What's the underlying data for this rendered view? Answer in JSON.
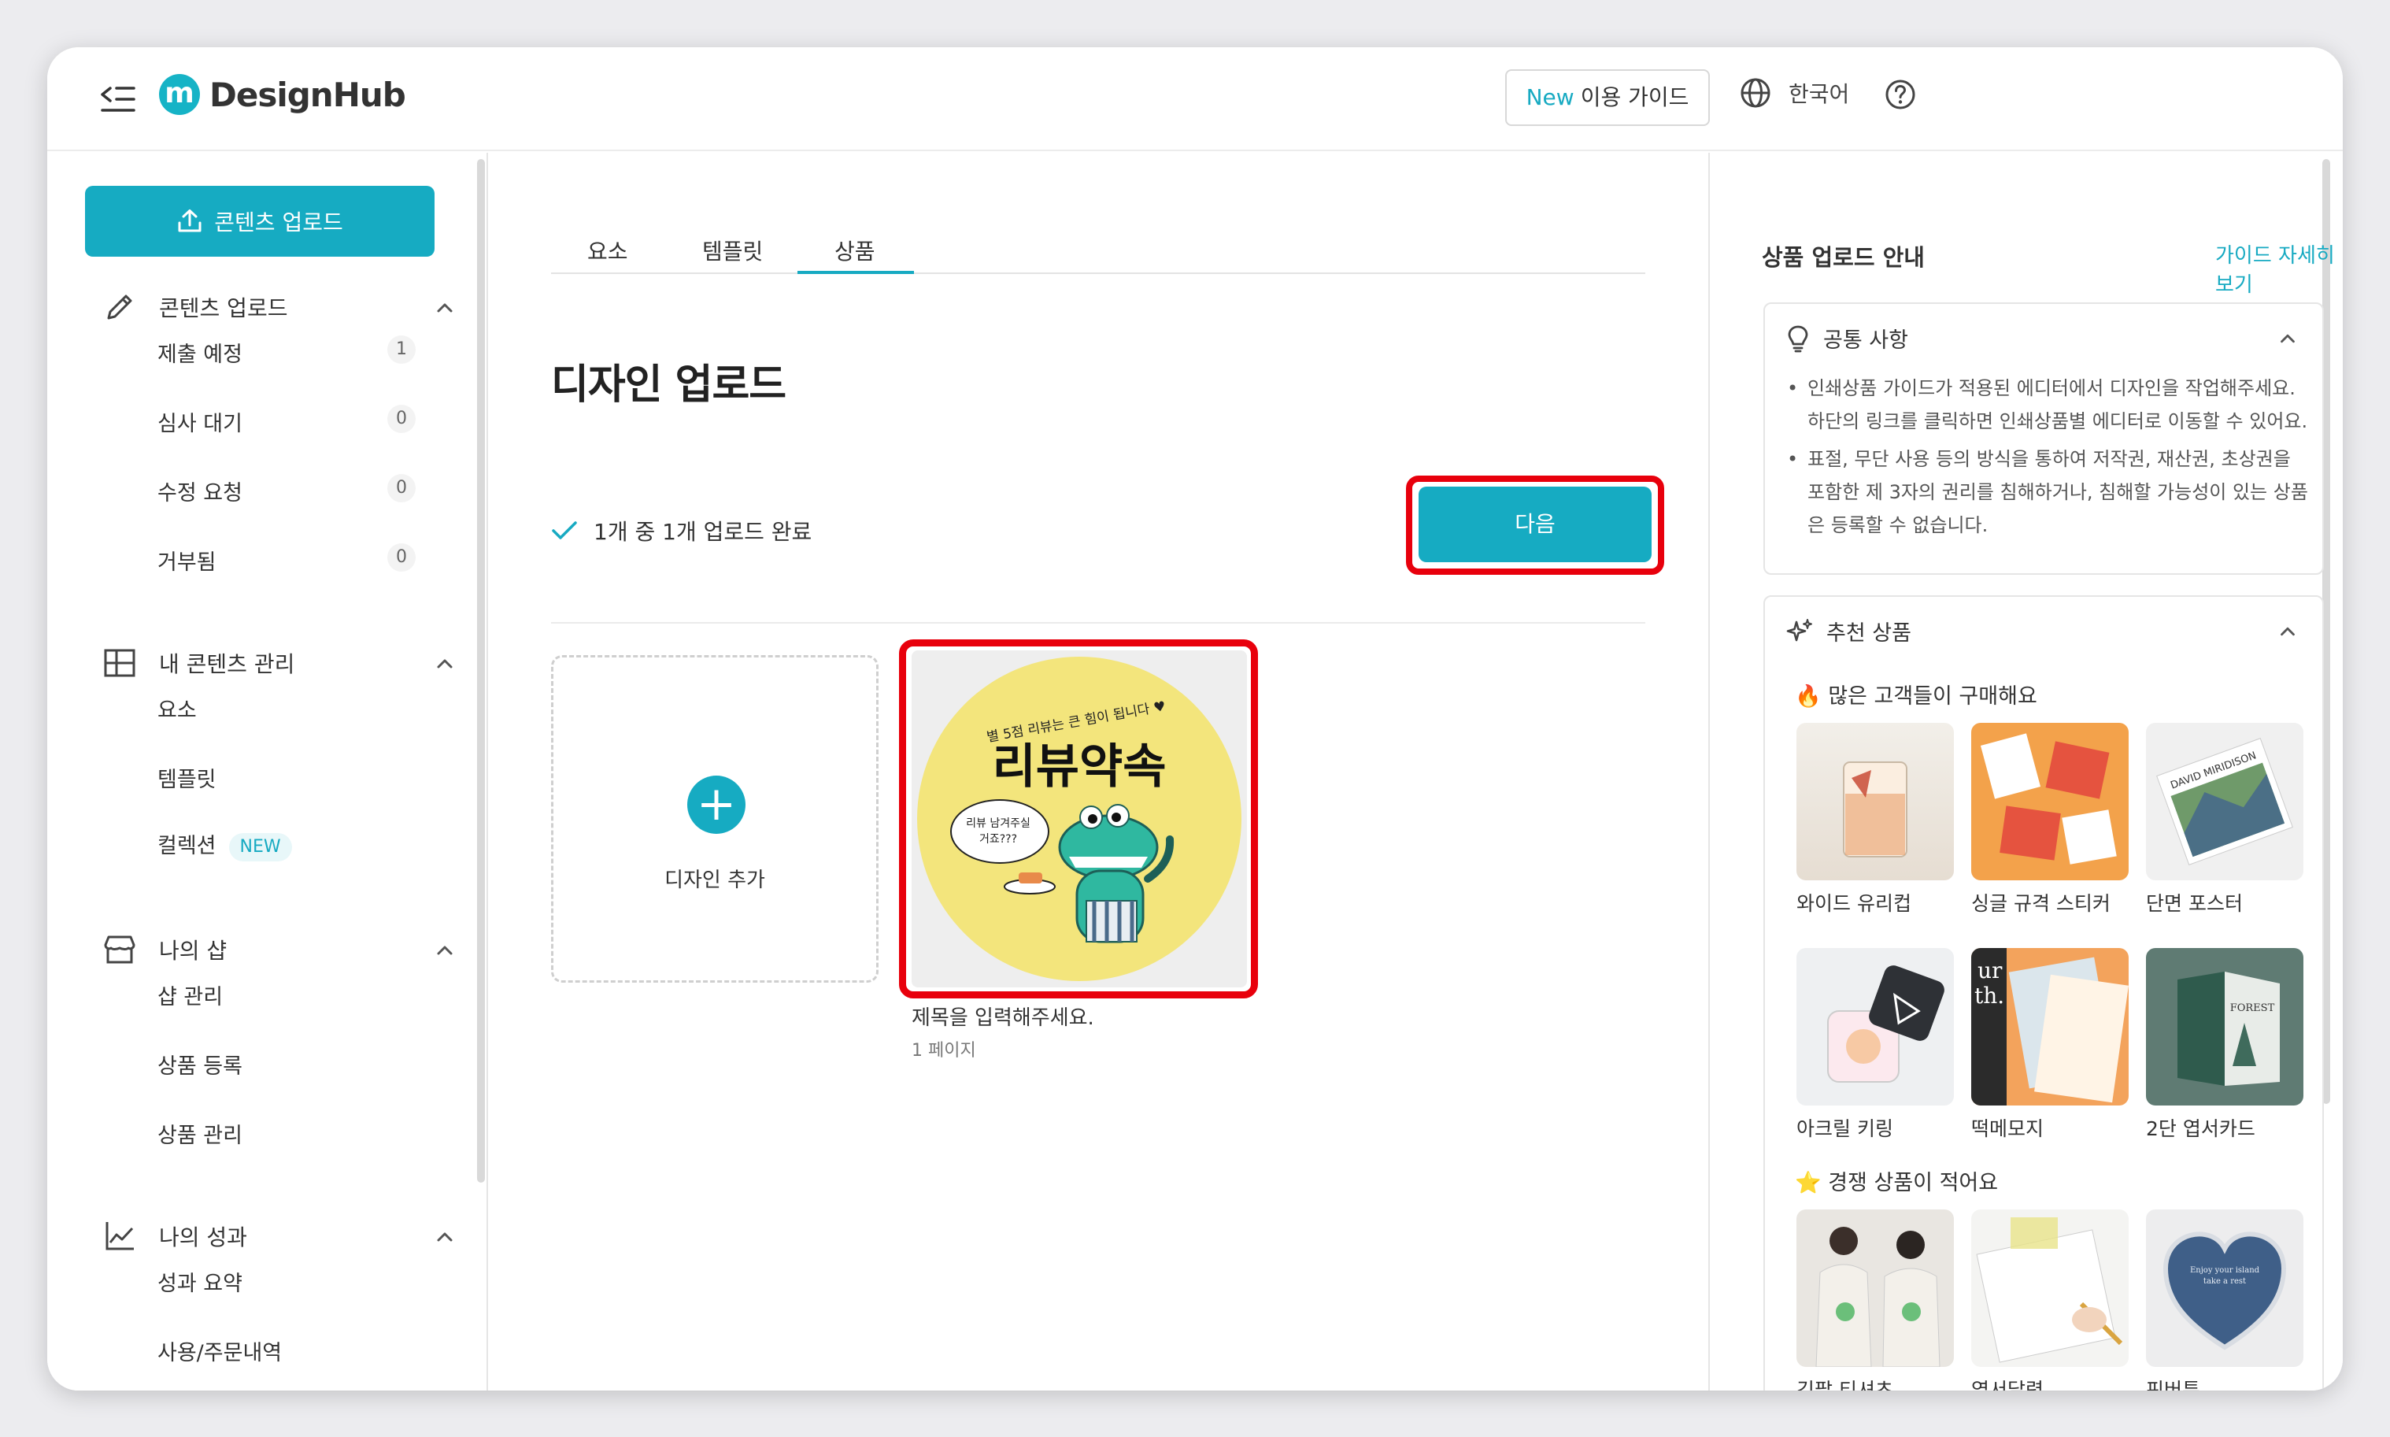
{
  "header": {
    "logo_mark": "m",
    "logo_text": "DesignHub",
    "guide_new": "New",
    "guide_label": "이용 가이드",
    "language": "한국어"
  },
  "sidebar": {
    "upload_button": "콘텐츠 업로드",
    "groups": [
      {
        "label": "콘텐츠 업로드",
        "icon": "pencil-icon",
        "items": [
          {
            "label": "제출 예정",
            "count": "1"
          },
          {
            "label": "심사 대기",
            "count": "0"
          },
          {
            "label": "수정 요청",
            "count": "0"
          },
          {
            "label": "거부됨",
            "count": "0"
          }
        ]
      },
      {
        "label": "내 콘텐츠 관리",
        "icon": "layout-grid-icon",
        "items": [
          {
            "label": "요소"
          },
          {
            "label": "템플릿"
          },
          {
            "label": "컬렉션",
            "badge": "NEW"
          }
        ]
      },
      {
        "label": "나의 샵",
        "icon": "store-icon",
        "items": [
          {
            "label": "샵 관리"
          },
          {
            "label": "상품 등록"
          },
          {
            "label": "상품 관리"
          }
        ]
      },
      {
        "label": "나의 성과",
        "icon": "chart-line-icon",
        "items": [
          {
            "label": "성과 요약"
          },
          {
            "label": "사용/주문내역"
          }
        ]
      }
    ]
  },
  "main": {
    "tabs": [
      {
        "label": "요소"
      },
      {
        "label": "템플릿"
      },
      {
        "label": "상품",
        "active": true
      }
    ],
    "title": "디자인 업로드",
    "status": "1개 중 1개 업로드 완료",
    "next_button": "다음",
    "add_design": "디자인 추가",
    "design": {
      "title_placeholder": "제목을 입력해주세요.",
      "pages": "1 페이지",
      "art_top": "별 5점 리뷰는 큰 힘이 됩니다 ♥",
      "art_main": "리뷰약속",
      "art_bubble_1": "리뷰 남겨주실",
      "art_bubble_2": "거죠???"
    }
  },
  "right_panel": {
    "title": "상품 업로드 안내",
    "guide_link": "가이드 자세히 보기",
    "common": {
      "heading": "공통 사항",
      "bullets": [
        "인쇄상품 가이드가 적용된 에디터에서 디자인을 작업해주세요. 하단의 링크를 클릭하면 인쇄상품별 에디터로 이동할 수 있어요.",
        "표절, 무단 사용 등의 방식을 통하여 저작권, 재산권, 초상권을 포함한 제 3자의 권리를 침해하거나, 침해할 가능성이 있는 상품은 등록할 수 없습니다."
      ]
    },
    "recommended": {
      "heading": "추천 상품",
      "popular_label": "많은 고객들이 구매해요",
      "popular": [
        "와이드 유리컵",
        "싱글 규격 스티커",
        "단면 포스터",
        "아크릴 키링",
        "떡메모지",
        "2단 엽서카드"
      ],
      "low_competition_label": "경쟁 상품이 적어요",
      "low_competition": [
        "긴팔 티셔츠",
        "엽서달력",
        "핀버튼"
      ],
      "thumb_text": {
        "poster": "DAVID MIRIDISON",
        "memo_1": "ur",
        "memo_2": "th.",
        "card": "FOREST",
        "pin_1": "Enjoy your island",
        "pin_2": "take a rest"
      }
    }
  },
  "colors": {
    "accent": "#16abc2",
    "highlight": "#e8000c",
    "art_yellow": "#f3e57c",
    "croc_green": "#2fb8a0"
  }
}
